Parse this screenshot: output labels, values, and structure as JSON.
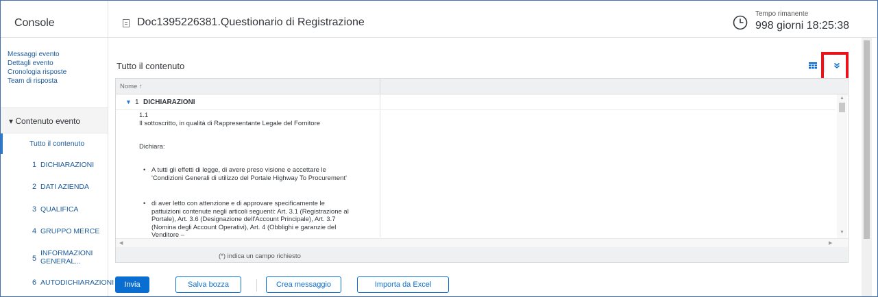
{
  "header": {
    "console_title": "Console",
    "doc_title": "Doc1395226381.Questionario di Registrazione",
    "time_label": "Tempo rimanente",
    "time_value": "998 giorni 18:25:38"
  },
  "left_nav": {
    "links": [
      "Messaggi evento",
      "Dettagli evento",
      "Cronologia risposte",
      "Team di risposta"
    ],
    "section_label": "▾ Contenuto evento",
    "items": [
      {
        "num": "",
        "label": "Tutto il contenuto"
      },
      {
        "num": "1",
        "label": "DICHIARAZIONI"
      },
      {
        "num": "2",
        "label": "DATI AZIENDA"
      },
      {
        "num": "3",
        "label": "QUALIFICA"
      },
      {
        "num": "4",
        "label": "GRUPPO MERCE"
      },
      {
        "num": "5",
        "label": "INFORMAZIONI GENERAL..."
      },
      {
        "num": "6",
        "label": "AUTODICHIARAZIONI"
      }
    ]
  },
  "main": {
    "title": "Tutto il contenuto",
    "table": {
      "column_header": "Nome ↑",
      "section": {
        "num": "1",
        "label": "DICHIARAZIONI"
      },
      "item_number": "1.1",
      "item_text": "Il sottoscritto, in qualità di Rappresentante Legale del Fornitore",
      "dichiara": "Dichiara:",
      "bullets": [
        "A tutti gli effetti di legge, di avere preso visione e accettare le 'Condizioni Generali di utilizzo del Portale Highway To Procurement'",
        "di aver letto con attenzione e di approvare specificamente le pattuizioni contenute negli articoli seguenti: Art. 3.1 (Registrazione al Portale), Art. 3.6 (Designazione dell'Account Principale), Art. 3.7 (Nomina degli Account Operativi), Art. 4 (Obblighi e garanzie del Venditore –"
      ],
      "footer_note": "(*) indica un campo richiesto"
    }
  },
  "actions": {
    "submit": "Invia",
    "save_draft": "Salva bozza",
    "create_message": "Crea messaggio",
    "import_excel": "Importa da Excel"
  },
  "colors": {
    "primary": "#0a6ed1",
    "link": "#1b5b9b",
    "highlight": "#e8141b"
  }
}
